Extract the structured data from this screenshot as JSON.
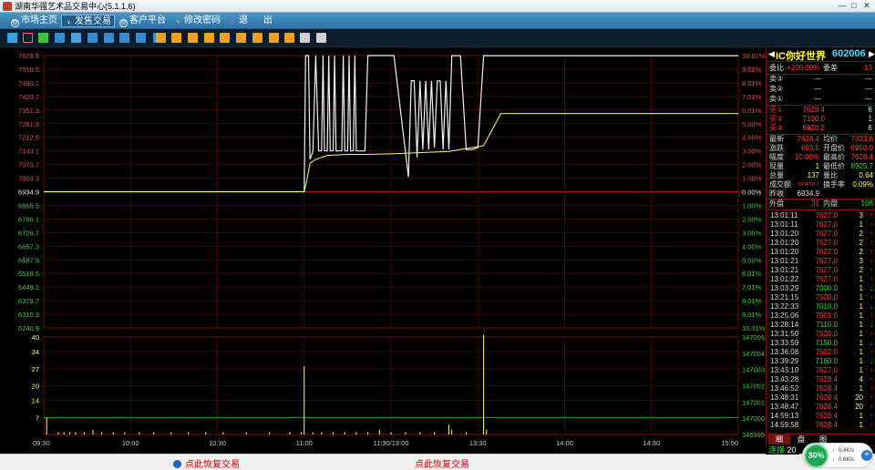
{
  "window": {
    "title": "湖南华强艺术品交易中心(5.1.1.6)"
  },
  "menu": [
    {
      "label": "市场主页",
      "icon": "@"
    },
    {
      "label": "发售交易",
      "icon": "¥",
      "active": true
    },
    {
      "label": "客户平台",
      "icon": "@"
    },
    {
      "label": "修改密码",
      "icon": "✎"
    },
    {
      "label": "退",
      "icon": "⏻"
    },
    {
      "label": "出",
      "icon": ""
    }
  ],
  "chart_data": [
    {
      "type": "line",
      "title": "",
      "y_left_ticks": [
        "7628.9",
        "7559.5",
        "7490.1",
        "7420.7",
        "7351.3",
        "7281.9",
        "7212.5",
        "7143.1",
        "7073.7",
        "7004.3",
        "6934.9",
        "6865.5",
        "6796.1",
        "6726.7",
        "6657.3",
        "6587.9",
        "6518.5",
        "6449.1",
        "6379.7",
        "6310.3",
        "6240.9"
      ],
      "y_right_ticks": [
        "10.01%",
        "9.01%",
        "8.01%",
        "7.01%",
        "6.01%",
        "5.00%",
        "4.00%",
        "3.00%",
        "2.00%",
        "1.00%",
        "0.00%",
        "1.00%",
        "2.00%",
        "3.00%",
        "4.00%",
        "5.00%",
        "6.01%",
        "7.01%",
        "8.01%",
        "9.01%",
        "10.01%"
      ],
      "ylim": [
        6240.9,
        7628.9
      ],
      "x_ticks": [
        "09:30",
        "10:00",
        "10:30",
        "11:00",
        "11:30/13:00",
        "13:30",
        "14:00",
        "14:30",
        "15:00"
      ],
      "xlim": [
        0,
        240
      ],
      "prev_close": 6934.9,
      "series": [
        {
          "kind": "price",
          "color": "#f0f0f0",
          "points": [
            [
              0,
              6934.9
            ],
            [
              87,
              6934.9
            ],
            [
              90,
              6934.9
            ],
            [
              90.5,
              7628.9
            ],
            [
              91.5,
              7628.9
            ],
            [
              92,
              7100
            ],
            [
              93,
              7140
            ],
            [
              94,
              7628.9
            ],
            [
              95,
              7143
            ],
            [
              96,
              7143
            ],
            [
              96.5,
              7628.9
            ],
            [
              97,
              7143
            ],
            [
              98,
              7143
            ],
            [
              98.5,
              7628.9
            ],
            [
              99,
              7143
            ],
            [
              100,
              7143
            ],
            [
              100.5,
              7628.9
            ],
            [
              101,
              7143
            ],
            [
              103,
              7143
            ],
            [
              103.5,
              7628.9
            ],
            [
              104,
              7143
            ],
            [
              105,
              7143
            ],
            [
              105.5,
              7628.9
            ],
            [
              106,
              7143
            ],
            [
              107,
              7143
            ],
            [
              107.5,
              7628.9
            ],
            [
              108,
              7143
            ],
            [
              111,
              7143
            ],
            [
              112,
              7628.9
            ],
            [
              120,
              7628.9
            ],
            [
              121,
              7628.9
            ],
            [
              126,
              7010
            ],
            [
              127,
              7501
            ],
            [
              128,
              7501
            ],
            [
              129,
              7110
            ],
            [
              130,
              7500
            ],
            [
              131,
              7150
            ],
            [
              132,
              7500
            ],
            [
              133,
              7150
            ],
            [
              134,
              7500
            ],
            [
              135,
              7160
            ],
            [
              136,
              7500
            ],
            [
              137,
              7500
            ],
            [
              138,
              7150
            ],
            [
              139,
              7500
            ],
            [
              140,
              7150
            ],
            [
              141,
              7628.4
            ],
            [
              144,
              7628.4
            ],
            [
              146,
              7150
            ],
            [
              148,
              7150
            ],
            [
              150,
              7160
            ],
            [
              152,
              7628.4
            ],
            [
              240,
              7628.4
            ]
          ]
        },
        {
          "kind": "average",
          "color": "#ffff60",
          "points": [
            [
              0,
              6934.9
            ],
            [
              90,
              6934.9
            ],
            [
              91,
              7000
            ],
            [
              92,
              7080
            ],
            [
              94,
              7100
            ],
            [
              98,
              7120
            ],
            [
              105,
              7125
            ],
            [
              111,
              7125
            ],
            [
              120,
              7128
            ],
            [
              140,
              7140
            ],
            [
              152,
              7170
            ],
            [
              158,
              7333.6
            ],
            [
              240,
              7333.6
            ]
          ]
        }
      ]
    },
    {
      "type": "bar",
      "title": "",
      "y_left_ticks": [
        "40",
        "34",
        "27",
        "20",
        "14",
        "7"
      ],
      "y_right_ticks": [
        "147005",
        "147004",
        "147003",
        "147002",
        "147001",
        "147000",
        "146999"
      ],
      "ylim": [
        0,
        40
      ],
      "baseline": 7,
      "x": [
        1,
        5,
        7,
        9,
        11,
        14,
        17,
        20,
        24,
        28,
        33,
        38,
        44,
        50,
        56,
        62,
        70,
        78,
        85,
        89,
        90,
        93,
        96,
        100,
        104,
        108,
        112,
        116,
        120,
        125,
        130,
        135,
        140,
        141,
        146,
        152,
        153
      ],
      "values": [
        7,
        1,
        1,
        1,
        1,
        1,
        2,
        1,
        1,
        1,
        1,
        1,
        1,
        1,
        1,
        1,
        1,
        1,
        1,
        1,
        28,
        1,
        1,
        1,
        1,
        1,
        1,
        2,
        1,
        1,
        1,
        1,
        4,
        2,
        1,
        41,
        2
      ]
    }
  ],
  "quote": {
    "name": "IC你好世界",
    "code": "602006",
    "weibi_label": "委比",
    "weibi_val": "+100.00%",
    "weicha_label": "委差",
    "weicha_val": "13",
    "asks": [
      {
        "label": "卖③",
        "price": "—",
        "vol": "—"
      },
      {
        "label": "卖②",
        "price": "—",
        "vol": "—"
      },
      {
        "label": "卖①",
        "price": "—",
        "vol": "—"
      }
    ],
    "bids": [
      {
        "label": "买①",
        "price": "7628.4",
        "vol": "6"
      },
      {
        "label": "买②",
        "price": "7100.0",
        "vol": "1"
      },
      {
        "label": "买③",
        "price": "6928.2",
        "vol": "6"
      }
    ],
    "stats": [
      {
        "l1": "最新",
        "v1": "7628.4",
        "l2": "均价",
        "v2": "7333.6"
      },
      {
        "l1": "涨跌",
        "v1": "693.5",
        "l2": "开盘价",
        "v2": "6950.0"
      },
      {
        "l1": "幅度",
        "v1": "10.00%",
        "l2": "最高价",
        "v2": "7628.4"
      },
      {
        "l1": "现量",
        "v1": "1",
        "l2": "最低价",
        "v2": "6925.7"
      },
      {
        "l1": "总量",
        "v1": "137",
        "l2": "量比",
        "v2": "0.64"
      },
      {
        "l1": "成交额",
        "v1": "1004707.1",
        "l2": "换手率",
        "v2": "0.09%"
      },
      {
        "l1": "昨收",
        "v1": "6934.9",
        "l2": "",
        "v2": ""
      }
    ],
    "waipan_label": "外盘",
    "waipan_val": "31",
    "neipan_label": "内盘",
    "neipan_val": "106"
  },
  "ticks": [
    {
      "t": "13:01:11",
      "p": "7627.0",
      "v": "3",
      "d": "↑"
    },
    {
      "t": "13:01:11",
      "p": "7627.0",
      "v": "1",
      "d": "↑"
    },
    {
      "t": "13:01:20",
      "p": "7627.0",
      "v": "2",
      "d": "↑"
    },
    {
      "t": "13:01:20",
      "p": "7627.0",
      "v": "2",
      "d": "↑"
    },
    {
      "t": "13:01:20",
      "p": "7627.0",
      "v": "2",
      "d": "↑"
    },
    {
      "t": "13:01:21",
      "p": "7627.0",
      "v": "3",
      "d": "↑"
    },
    {
      "t": "13:01:21",
      "p": "7627.0",
      "v": "2",
      "d": "↑"
    },
    {
      "t": "13:01:22",
      "p": "7627.0",
      "v": "1",
      "d": "↑"
    },
    {
      "t": "13:03:29",
      "p": "7000.0",
      "v": "1",
      "d": "↓"
    },
    {
      "t": "13:21:15",
      "p": "7500.0",
      "v": "1",
      "d": "↑"
    },
    {
      "t": "13:22:33",
      "p": "7010.0",
      "v": "1",
      "d": "↓"
    },
    {
      "t": "13:25:06",
      "p": "7501.0",
      "v": "1",
      "d": "↑"
    },
    {
      "t": "13:28:14",
      "p": "7110.0",
      "v": "1",
      "d": "↓"
    },
    {
      "t": "13:31:50",
      "p": "7500.0",
      "v": "1",
      "d": "↑"
    },
    {
      "t": "13:33:59",
      "p": "7150.0",
      "v": "1",
      "d": "↓"
    },
    {
      "t": "13:36:08",
      "p": "7502.0",
      "v": "1",
      "d": "↑"
    },
    {
      "t": "13:39:29",
      "p": "7160.0",
      "v": "1",
      "d": "↓"
    },
    {
      "t": "13:43:10",
      "p": "7627.0",
      "v": "1",
      "d": "↑"
    },
    {
      "t": "13:43:28",
      "p": "7628.4",
      "v": "4",
      "d": "↑"
    },
    {
      "t": "13:46:52",
      "p": "7628.4",
      "v": "1",
      "d": "↑"
    },
    {
      "t": "13:48:31",
      "p": "7628.4",
      "v": "20",
      "d": "↑"
    },
    {
      "t": "13:48:47",
      "p": "7628.4",
      "v": "20",
      "d": "↑"
    },
    {
      "t": "14:59:13",
      "p": "7628.4",
      "v": "1",
      "d": "↑"
    },
    {
      "t": "14:59:58",
      "p": "7628.4",
      "v": "1",
      "d": "↑"
    }
  ],
  "panel_tabs": [
    "细",
    "盘",
    "图"
  ],
  "status": {
    "msg_left": "点此恢复交易",
    "msg_mid": "点此恢复交易",
    "conn": "连接",
    "conn_num": "20"
  },
  "gauge": {
    "pct": "30%",
    "up": "0.4K/s",
    "down": "0.6K/s"
  }
}
